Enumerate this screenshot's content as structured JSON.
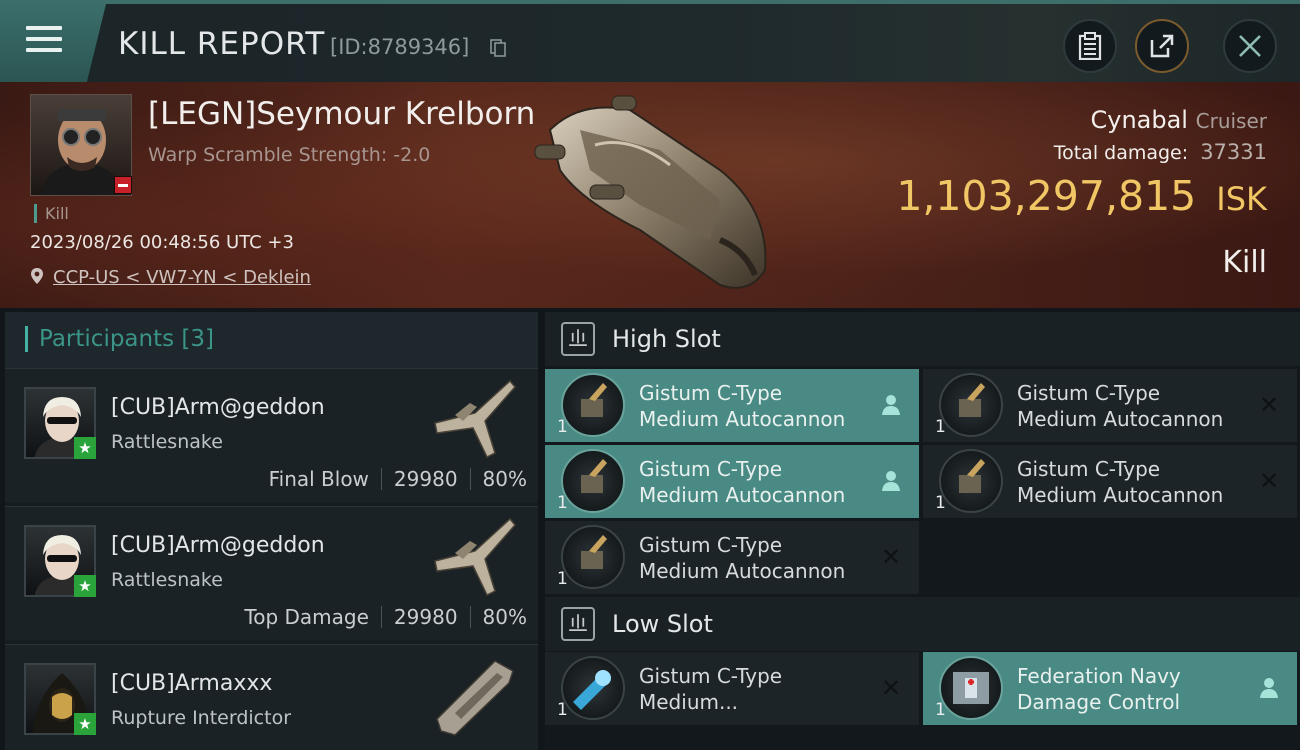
{
  "header": {
    "title": "KILL REPORT",
    "report_id": "[ID:8789346]"
  },
  "victim": {
    "name": "[LEGN]Seymour Krelborn",
    "scramble": "Warp Scramble Strength: -2.0",
    "tag": "Kill",
    "datetime": "2023/08/26 00:48:56 UTC +3",
    "location": "CCP-US < VW7-YN < Deklein",
    "ship": "Cynabal",
    "ship_class": "Cruiser",
    "total_damage_label": "Total damage:",
    "total_damage": "37331",
    "isk_value": "1,103,297,815",
    "isk_unit": "ISK",
    "result": "Kill"
  },
  "participants": {
    "label": "Participants",
    "count": "[3]",
    "rows": [
      {
        "name": "[CUB]Arm@geddon",
        "ship": "Rattlesnake",
        "role": "Final Blow",
        "damage": "29980",
        "percent": "80%"
      },
      {
        "name": "[CUB]Arm@geddon",
        "ship": "Rattlesnake",
        "role": "Top Damage",
        "damage": "29980",
        "percent": "80%"
      },
      {
        "name": "[CUB]Armaxxx",
        "ship": "Rupture Interdictor",
        "role": "",
        "damage": "",
        "percent": ""
      }
    ]
  },
  "high_slot": {
    "label": "High Slot",
    "items": [
      {
        "line1": "Gistum C-Type",
        "line2": "Medium Autocannon",
        "qty": "1"
      },
      {
        "line1": "Gistum C-Type",
        "line2": "Medium Autocannon",
        "qty": "1"
      },
      {
        "line1": "Gistum C-Type",
        "line2": "Medium Autocannon",
        "qty": "1"
      },
      {
        "line1": "Gistum C-Type",
        "line2": "Medium Autocannon",
        "qty": "1"
      },
      {
        "line1": "Gistum C-Type",
        "line2": "Medium Autocannon",
        "qty": "1"
      }
    ]
  },
  "low_slot": {
    "label": "Low Slot",
    "items": [
      {
        "line1": "Gistum C-Type",
        "line2": "Medium...",
        "qty": "1"
      },
      {
        "line1": "Federation Navy",
        "line2": "Damage Control",
        "qty": "1"
      }
    ]
  },
  "colors": {
    "accent": "#45b3a4",
    "isk": "#f1c766",
    "active_slot": "#4a8a84",
    "badge_red": "#c62028",
    "badge_green": "#2aa33b"
  }
}
